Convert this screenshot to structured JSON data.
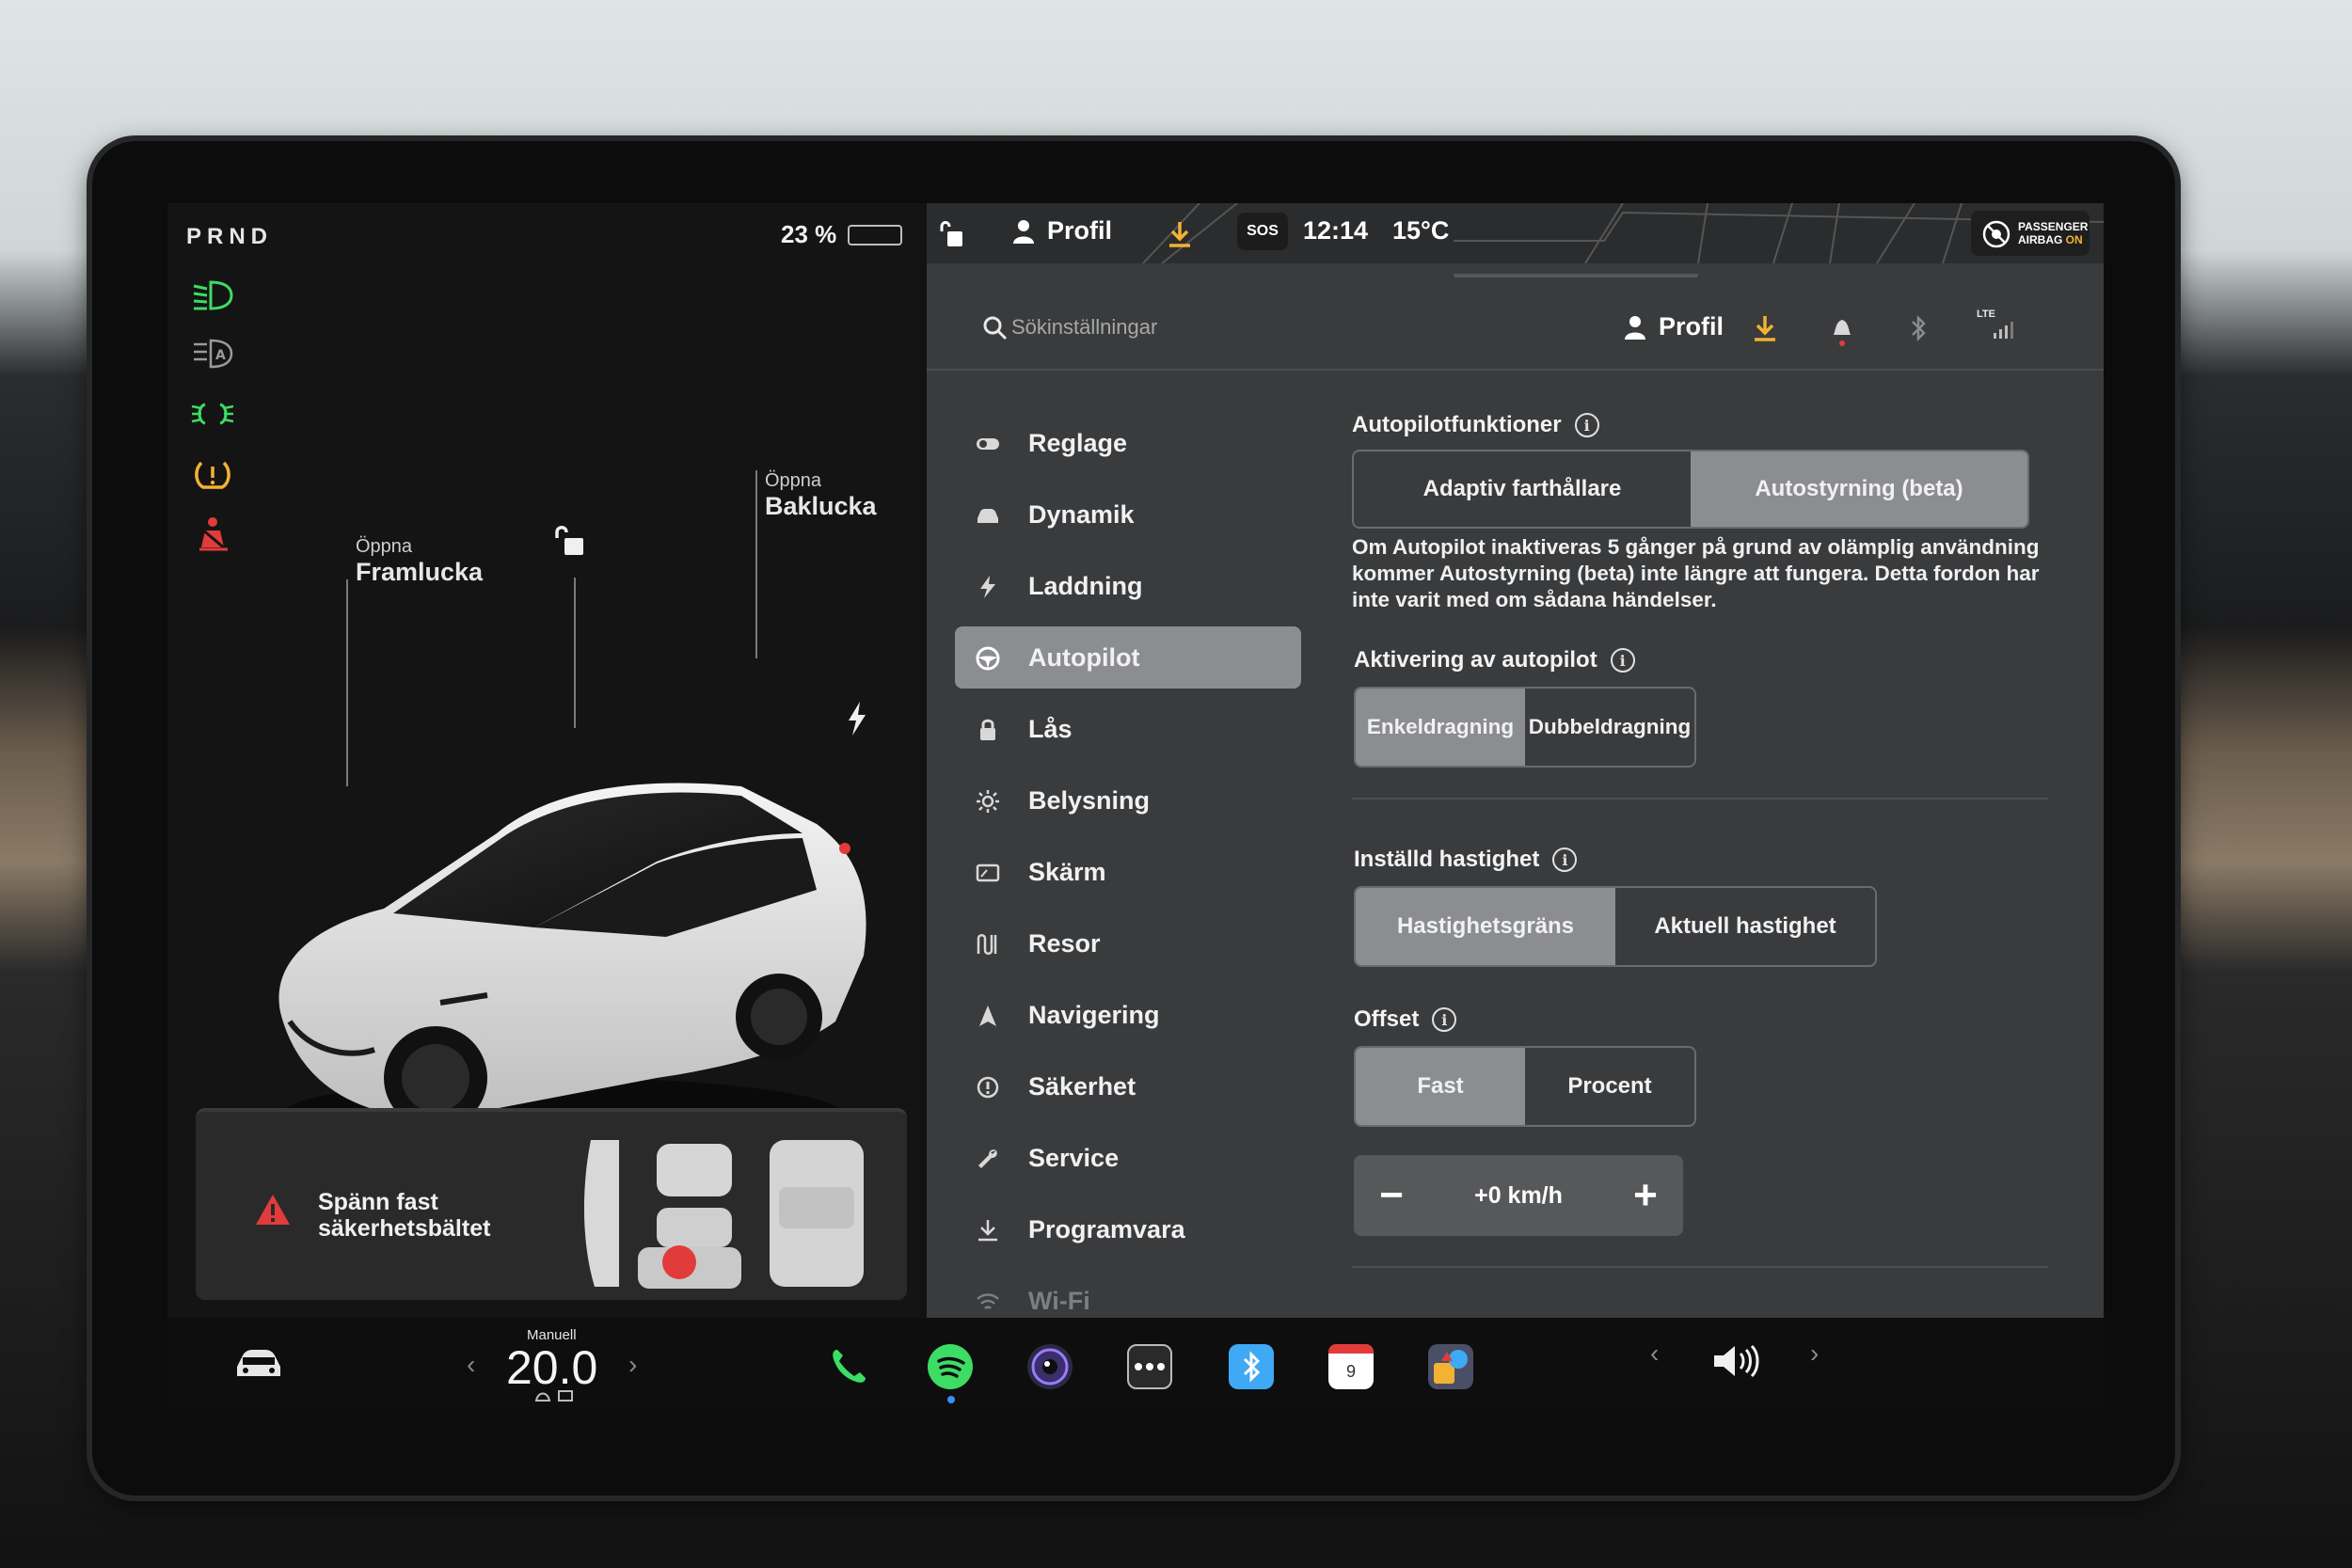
{
  "gear": "PRND",
  "battery": {
    "percent_text": "23 %",
    "level": 0.23
  },
  "car": {
    "frunk_small": "Öppna",
    "frunk_big": "Framlucka",
    "trunk_small": "Öppna",
    "trunk_big": "Baklucka"
  },
  "seatbelt_alert": {
    "line1": "Spänn fast",
    "line2": "säkerhetsbältet"
  },
  "statusbar": {
    "profile": "Profil",
    "sos": "SOS",
    "time": "12:14",
    "temp": "15°C",
    "airbag_line1": "PASSENGER",
    "airbag_line2a": "AIRBAG ",
    "airbag_line2b": "ON"
  },
  "search": {
    "placeholder": "Sökinställningar",
    "profile": "Profil",
    "lte": "LTE"
  },
  "nav": [
    {
      "label": "Reglage",
      "icon": "toggle-icon"
    },
    {
      "label": "Dynamik",
      "icon": "car-icon"
    },
    {
      "label": "Laddning",
      "icon": "bolt-icon"
    },
    {
      "label": "Autopilot",
      "icon": "steering-wheel-icon",
      "active": true
    },
    {
      "label": "Lås",
      "icon": "lock-icon"
    },
    {
      "label": "Belysning",
      "icon": "sun-icon"
    },
    {
      "label": "Skärm",
      "icon": "display-icon"
    },
    {
      "label": "Resor",
      "icon": "trips-icon"
    },
    {
      "label": "Navigering",
      "icon": "navigation-icon"
    },
    {
      "label": "Säkerhet",
      "icon": "safety-icon"
    },
    {
      "label": "Service",
      "icon": "wrench-icon"
    },
    {
      "label": "Programvara",
      "icon": "download-icon"
    },
    {
      "label": "Wi-Fi",
      "icon": "wifi-icon"
    }
  ],
  "autopilot": {
    "features_title": "Autopilotfunktioner",
    "features_options": [
      "Adaptiv farthållare",
      "Autostyrning (beta)"
    ],
    "features_selected": 1,
    "description": "Om Autopilot inaktiveras 5 gånger på grund av olämplig användning kommer Autostyrning (beta) inte längre att fungera. Detta fordon har inte varit med om sådana händelser.",
    "activation_title": "Aktivering av autopilot",
    "activation_options": [
      "Enkeldragning",
      "Dubbeldragning"
    ],
    "activation_selected": 0,
    "speed_title": "Inställd hastighet",
    "speed_options": [
      "Hastighetsgräns",
      "Aktuell hastighet"
    ],
    "speed_selected": 0,
    "offset_title": "Offset",
    "offset_options": [
      "Fast",
      "Procent"
    ],
    "offset_selected": 0,
    "offset_value": "+0 km/h",
    "minus": "−",
    "plus": "+"
  },
  "dock": {
    "climate_mode": "Manuell",
    "temperature": "20.0",
    "calendar_day": "9"
  },
  "colors": {
    "accent_active": "#8b8d90",
    "panel": "#3a3b3d",
    "warning_red": "#e23b3b",
    "download_yellow": "#f2b233",
    "green": "#3ddc64"
  }
}
